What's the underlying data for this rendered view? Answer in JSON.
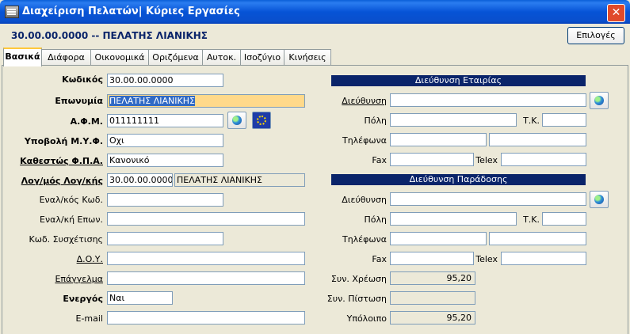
{
  "window": {
    "title": "Διαχείριση Πελατών| Κύριες Εργασίες",
    "close_glyph": "✕"
  },
  "header": {
    "record": "30.00.00.0000 -- ΠΕΛΑΤΗΣ ΛΙΑΝΙΚΗΣ",
    "options_label": "Επιλογές"
  },
  "tabs": [
    "Βασικά",
    "Διάφορα",
    "Οικονομικά",
    "Οριζόμενα",
    "Αυτοκ.",
    "Ισοζύγιο",
    "Κινήσεις"
  ],
  "left": {
    "code": {
      "label": "Κωδικός",
      "value": "30.00.00.0000"
    },
    "name": {
      "label": "Επωνυμία",
      "value": "ΠΕΛΑΤΗΣ ΛΙΑΝΙΚΗΣ"
    },
    "afm": {
      "label": "Α.Φ.Μ.",
      "value": "011111111"
    },
    "myf": {
      "label": "Υποβολή Μ.Υ.Φ.",
      "value": "Οχι"
    },
    "vat_status": {
      "label": "Καθεστώς Φ.Π.Α.",
      "value": "Κανονικό"
    },
    "account": {
      "label": "Λογ/μός Λογ/κής",
      "value": "30.00.00.0000",
      "name": "ΠΕΛΑΤΗΣ ΛΙΑΝΙΚΗΣ"
    },
    "alt_code": {
      "label": "Εναλ/κός Κωδ.",
      "value": ""
    },
    "alt_name": {
      "label": "Εναλ/κή Επων.",
      "value": ""
    },
    "relation_code": {
      "label": "Κωδ. Συσχέτισης",
      "value": ""
    },
    "doy": {
      "label": "Δ.Ο.Υ.",
      "value": ""
    },
    "profession": {
      "label": "Επάγγελμα",
      "value": ""
    },
    "active": {
      "label": "Ενεργός",
      "value": "Ναι"
    },
    "email": {
      "label": "E-mail",
      "value": ""
    }
  },
  "company_address": {
    "title": "Διεύθυνση Εταιρίας",
    "address_label": "Διεύθυνση",
    "city_label": "Πόλη",
    "zip_label": "Τ.Κ.",
    "phones_label": "Τηλέφωνα",
    "fax_label": "Fax",
    "telex_label": "Telex"
  },
  "delivery_address": {
    "title": "Διεύθυνση Παράδοσης",
    "address_label": "Διεύθυνση",
    "city_label": "Πόλη",
    "zip_label": "Τ.Κ.",
    "phones_label": "Τηλέφωνα",
    "fax_label": "Fax",
    "telex_label": "Telex"
  },
  "totals": {
    "debit_label": "Συν. Χρέωση",
    "debit_value": "95,20",
    "credit_label": "Συν. Πίστωση",
    "credit_value": "",
    "balance_label": "Υπόλοιπο",
    "balance_value": "95,20"
  },
  "icons": {
    "app": "app-icon",
    "globe": "globe-icon",
    "eu": "eu-flag-icon"
  }
}
